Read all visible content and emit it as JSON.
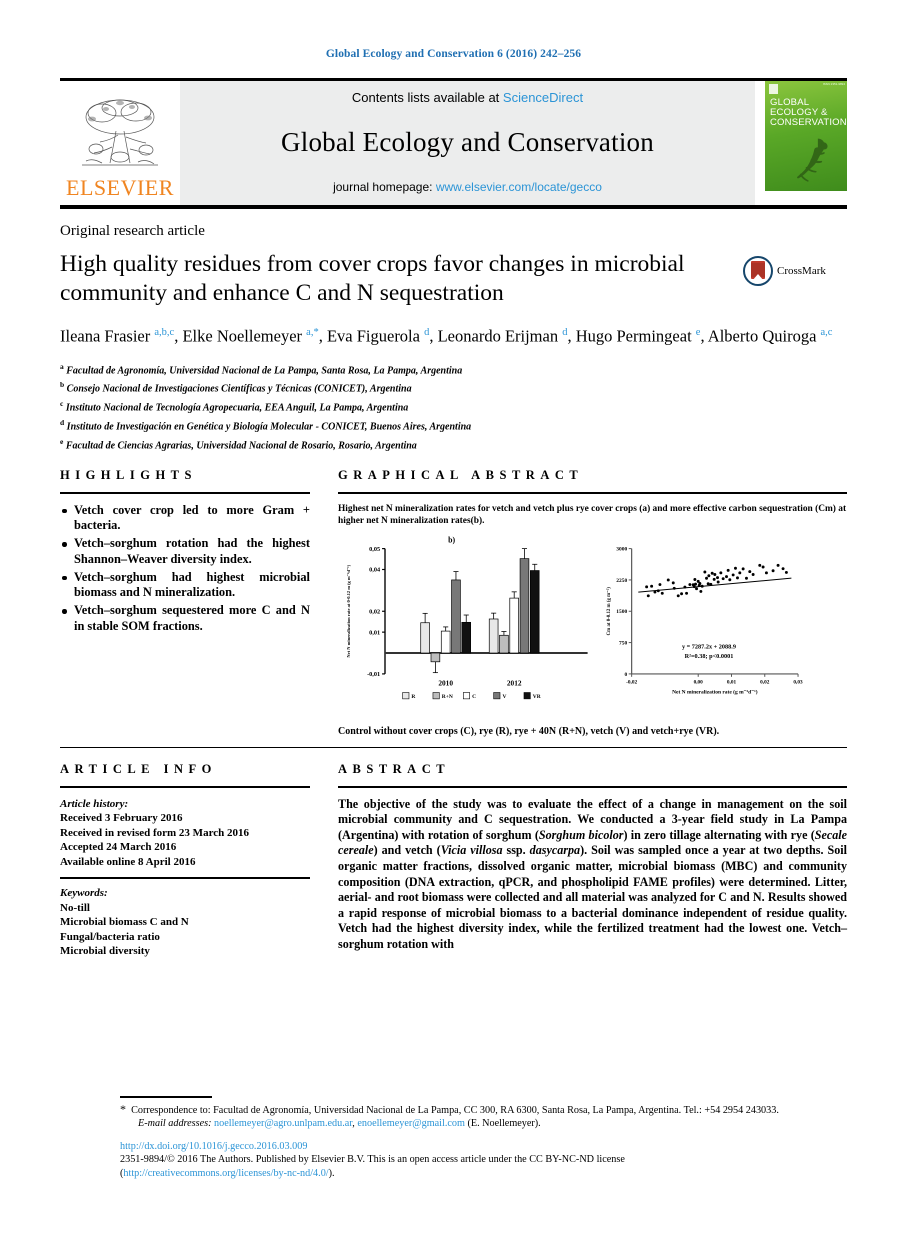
{
  "running_head": "Global Ecology and Conservation 6 (2016) 242–256",
  "masthead": {
    "contents_prefix": "Contents lists available at ",
    "contents_link": "ScienceDirect",
    "journal_name": "Global Ecology and Conservation",
    "homepage_prefix": "journal homepage: ",
    "homepage_link": "www.elsevier.com/locate/gecco",
    "publisher": "ELSEVIER",
    "cover_title": "GLOBAL ECOLOGY & CONSERVATION"
  },
  "article": {
    "type": "Original research article",
    "title": "High quality residues from cover crops favor changes in microbial community and enhance C and N sequestration",
    "crossmark_label": "CrossMark",
    "authors_html": "Ileana Frasier <sup>a,b,c</sup>, Elke Noellemeyer <sup>a,*</sup>, Eva Figuerola <sup>d</sup>, Leonardo Erijman <sup>d</sup>, Hugo Permingeat <sup>e</sup>, Alberto Quiroga <sup>a,c</sup>",
    "affiliations": [
      {
        "mark": "a",
        "text": "Facultad de Agronomía, Universidad Nacional de La Pampa, Santa Rosa, La Pampa, Argentina"
      },
      {
        "mark": "b",
        "text": "Consejo Nacional de Investigaciones Científicas y Técnicas (CONICET), Argentina"
      },
      {
        "mark": "c",
        "text": "Instituto Nacional de Tecnología Agropecuaria, EEA Anguil, La Pampa, Argentina"
      },
      {
        "mark": "d",
        "text": "Instituto de Investigación en Genética y Biología Molecular - CONICET, Buenos Aires, Argentina"
      },
      {
        "mark": "e",
        "text": "Facultad de Ciencias Agrarias, Universidad Nacional de Rosario, Rosario, Argentina"
      }
    ]
  },
  "highlights": {
    "heading": "HIGHLIGHTS",
    "items": [
      "Vetch cover crop led to more Gram + bacteria.",
      "Vetch–sorghum rotation had the highest Shannon–Weaver diversity index.",
      "Vetch–sorghum had highest microbial biomass and N mineralization.",
      "Vetch–sorghum sequestered more C and N in stable SOM fractions."
    ]
  },
  "graphical_abstract": {
    "heading": "GRAPHICAL ABSTRACT",
    "caption": "Highest net N mineralization rates for vetch and vetch plus rye cover crops (a) and more effective carbon sequestration (Cm) at higher net N mineralization rates(b).",
    "footnote": "Control without cover crops (C), rye (R), rye + 40N (R+N), vetch (V) and vetch+rye (VR)."
  },
  "article_info": {
    "heading": "ARTICLE INFO",
    "history_label": "Article history:",
    "history": [
      "Received 3 February 2016",
      "Received in revised form 23 March 2016",
      "Accepted 24 March 2016",
      "Available online 8 April 2016"
    ],
    "keywords_label": "Keywords:",
    "keywords": [
      "No-till",
      "Microbial biomass C and N",
      "Fungal/bacteria ratio",
      "Microbial diversity"
    ]
  },
  "abstract": {
    "heading": "ABSTRACT",
    "paragraph_html": "The objective of the study was to evaluate the effect of a change in management on the soil microbial community and C sequestration. We conducted a 3-year field study in La Pampa (Argentina) with rotation of sorghum (<i>Sorghum bicolor</i>) in zero tillage alternating with rye (<i>Secale cereale</i>) and vetch (<i>Vicia villosa</i> ssp. <i>dasycarpa</i>). Soil was sampled once a year at two depths. Soil organic matter fractions, dissolved organic matter, microbial biomass (MBC) and community composition (DNA extraction, qPCR, and phospholipid FAME profiles) were determined. Litter, aerial- and root biomass were collected and all material was analyzed for C and N. Results showed a rapid response of microbial biomass to a bacterial dominance independent of residue quality. Vetch had the highest diversity index, while the fertilized treatment had the lowest one. Vetch–sorghum  rotation with"
  },
  "footnotes": {
    "correspondence": "Correspondence to: Facultad de Agronomía, Universidad Nacional de La Pampa, CC 300, RA 6300, Santa Rosa, La Pampa, Argentina. Tel.: +54 2954 243033.",
    "email_label": "E-mail addresses:",
    "email1": "noellemeyer@agro.unlpam.edu.ar",
    "email2": "enoellemeyer@gmail.com",
    "email_suffix": "(E. Noellemeyer).",
    "doi": "http://dx.doi.org/10.1016/j.gecco.2016.03.009",
    "copyright_pre": "2351-9894/© 2016 The Authors. Published by Elsevier B.V. This is an open access article under the CC BY-NC-ND license (",
    "license_link": "http://creativecommons.org/licenses/by-nc-nd/4.0/",
    "copyright_post": ")."
  },
  "chart_data": [
    {
      "type": "bar",
      "panel_label": "b)",
      "title": "",
      "ylabel": "Net N mineralization rate at 0-0.12 m (g m⁻²d⁻¹)",
      "xlabel": "",
      "ylim": [
        -0.01,
        0.05
      ],
      "yticks": [
        -0.01,
        0.01,
        0.02,
        0.04,
        0.05
      ],
      "ytick_labels": [
        "-0,01",
        "0,01",
        "0,02",
        "0,04",
        "0,05"
      ],
      "categories": [
        "2010",
        "2012"
      ],
      "legend": [
        "R",
        "R+N",
        "C",
        "V",
        "VR"
      ],
      "legend_colors": [
        "#e8e8e8",
        "#bdbdbd",
        "#ffffff",
        "#787878",
        "#111111"
      ],
      "series": [
        {
          "name": "R",
          "values": [
            0.0145,
            0.0163
          ],
          "errors": [
            0.0045,
            0.0028
          ]
        },
        {
          "name": "R+N",
          "values": [
            -0.0042,
            0.0085
          ],
          "errors": [
            0.0052,
            0.0018
          ]
        },
        {
          "name": "C",
          "values": [
            0.0105,
            0.0263
          ],
          "errors": [
            0.002,
            0.003
          ]
        },
        {
          "name": "V",
          "values": [
            0.035,
            0.0452
          ],
          "errors": [
            0.004,
            0.0048
          ]
        },
        {
          "name": "VR",
          "values": [
            0.0147,
            0.0395
          ],
          "errors": [
            0.0035,
            0.003
          ]
        }
      ]
    },
    {
      "type": "scatter",
      "title": "",
      "ylabel": "Cm at 0-0.12 m (g m⁻²)",
      "xlabel": "Net N mineralization rate (g m⁻²d⁻¹)",
      "xlim": [
        -0.02,
        0.03
      ],
      "ylim": [
        0,
        3000
      ],
      "xticks": [
        -0.02,
        0.0,
        0.01,
        0.02,
        0.03
      ],
      "xtick_labels": [
        "-0,02",
        "0,00",
        "0,01",
        "0,02",
        "0,03"
      ],
      "yticks": [
        0,
        750,
        1500,
        2250,
        3000
      ],
      "ytick_labels": [
        "0",
        "750",
        "1500",
        "2250",
        "3000"
      ],
      "annotation_eq": "y = 7287.2x + 2088.9",
      "annotation_stat": "R²=0.38; p<0.0001",
      "fit": {
        "slope": 7287.2,
        "intercept": 2088.9,
        "r2": 0.38,
        "p": "<0.0001"
      },
      "points": [
        [
          -0.0155,
          2085
        ],
        [
          -0.015,
          1870
        ],
        [
          -0.014,
          2100
        ],
        [
          -0.013,
          1960
        ],
        [
          -0.012,
          1990
        ],
        [
          -0.0115,
          2140
        ],
        [
          -0.0108,
          1930
        ],
        [
          -0.009,
          2250
        ],
        [
          -0.0075,
          2180
        ],
        [
          -0.0072,
          2050
        ],
        [
          -0.006,
          1870
        ],
        [
          -0.005,
          1920
        ],
        [
          -0.004,
          2080
        ],
        [
          -0.0035,
          1930
        ],
        [
          -0.0025,
          2140
        ],
        [
          -0.0015,
          2135
        ],
        [
          -0.0012,
          2090
        ],
        [
          -0.001,
          2260
        ],
        [
          -0.0008,
          2150
        ],
        [
          -0.0005,
          2040
        ],
        [
          0.0,
          2215
        ],
        [
          0.0003,
          2120
        ],
        [
          0.0005,
          2165
        ],
        [
          0.0008,
          1975
        ],
        [
          0.0012,
          2100
        ],
        [
          0.002,
          2440
        ],
        [
          0.0025,
          2290
        ],
        [
          0.003,
          2160
        ],
        [
          0.0032,
          2350
        ],
        [
          0.0038,
          2145
        ],
        [
          0.0042,
          2410
        ],
        [
          0.0048,
          2265
        ],
        [
          0.005,
          2380
        ],
        [
          0.0058,
          2305
        ],
        [
          0.006,
          2200
        ],
        [
          0.0068,
          2420
        ],
        [
          0.0075,
          2280
        ],
        [
          0.0085,
          2330
        ],
        [
          0.009,
          2480
        ],
        [
          0.0095,
          2255
        ],
        [
          0.0105,
          2370
        ],
        [
          0.0112,
          2530
        ],
        [
          0.0118,
          2300
        ],
        [
          0.0125,
          2420
        ],
        [
          0.0135,
          2515
        ],
        [
          0.0145,
          2290
        ],
        [
          0.0155,
          2450
        ],
        [
          0.0165,
          2380
        ],
        [
          0.0185,
          2600
        ],
        [
          0.0195,
          2560
        ],
        [
          0.0205,
          2420
        ],
        [
          0.0225,
          2470
        ],
        [
          0.024,
          2600
        ],
        [
          0.0255,
          2520
        ],
        [
          0.0265,
          2430
        ]
      ]
    }
  ]
}
